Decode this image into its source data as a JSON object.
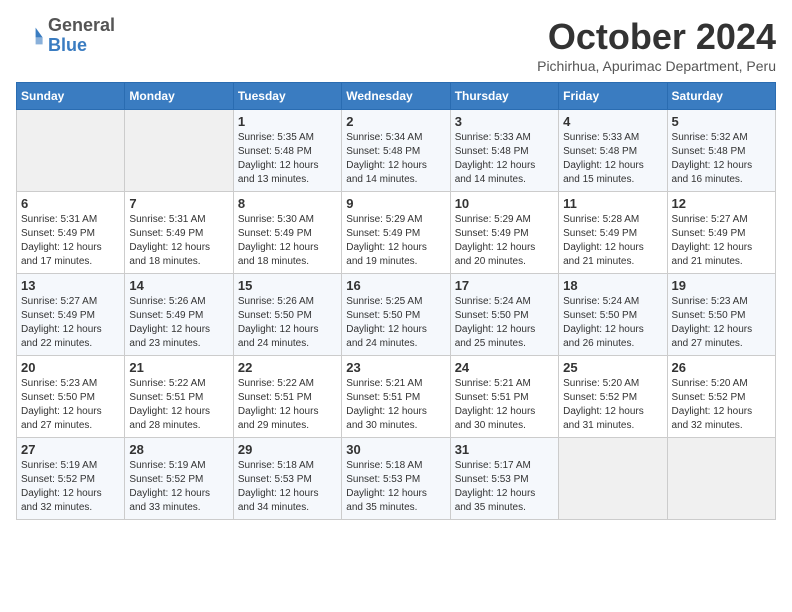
{
  "header": {
    "logo_line1": "General",
    "logo_line2": "Blue",
    "month_title": "October 2024",
    "location": "Pichirhua, Apurimac Department, Peru"
  },
  "weekdays": [
    "Sunday",
    "Monday",
    "Tuesday",
    "Wednesday",
    "Thursday",
    "Friday",
    "Saturday"
  ],
  "weeks": [
    [
      {
        "day": "",
        "empty": true
      },
      {
        "day": "",
        "empty": true
      },
      {
        "day": "1",
        "sunrise": "5:35 AM",
        "sunset": "5:48 PM",
        "daylight": "12 hours and 13 minutes."
      },
      {
        "day": "2",
        "sunrise": "5:34 AM",
        "sunset": "5:48 PM",
        "daylight": "12 hours and 14 minutes."
      },
      {
        "day": "3",
        "sunrise": "5:33 AM",
        "sunset": "5:48 PM",
        "daylight": "12 hours and 14 minutes."
      },
      {
        "day": "4",
        "sunrise": "5:33 AM",
        "sunset": "5:48 PM",
        "daylight": "12 hours and 15 minutes."
      },
      {
        "day": "5",
        "sunrise": "5:32 AM",
        "sunset": "5:48 PM",
        "daylight": "12 hours and 16 minutes."
      }
    ],
    [
      {
        "day": "6",
        "sunrise": "5:31 AM",
        "sunset": "5:49 PM",
        "daylight": "12 hours and 17 minutes."
      },
      {
        "day": "7",
        "sunrise": "5:31 AM",
        "sunset": "5:49 PM",
        "daylight": "12 hours and 18 minutes."
      },
      {
        "day": "8",
        "sunrise": "5:30 AM",
        "sunset": "5:49 PM",
        "daylight": "12 hours and 18 minutes."
      },
      {
        "day": "9",
        "sunrise": "5:29 AM",
        "sunset": "5:49 PM",
        "daylight": "12 hours and 19 minutes."
      },
      {
        "day": "10",
        "sunrise": "5:29 AM",
        "sunset": "5:49 PM",
        "daylight": "12 hours and 20 minutes."
      },
      {
        "day": "11",
        "sunrise": "5:28 AM",
        "sunset": "5:49 PM",
        "daylight": "12 hours and 21 minutes."
      },
      {
        "day": "12",
        "sunrise": "5:27 AM",
        "sunset": "5:49 PM",
        "daylight": "12 hours and 21 minutes."
      }
    ],
    [
      {
        "day": "13",
        "sunrise": "5:27 AM",
        "sunset": "5:49 PM",
        "daylight": "12 hours and 22 minutes."
      },
      {
        "day": "14",
        "sunrise": "5:26 AM",
        "sunset": "5:49 PM",
        "daylight": "12 hours and 23 minutes."
      },
      {
        "day": "15",
        "sunrise": "5:26 AM",
        "sunset": "5:50 PM",
        "daylight": "12 hours and 24 minutes."
      },
      {
        "day": "16",
        "sunrise": "5:25 AM",
        "sunset": "5:50 PM",
        "daylight": "12 hours and 24 minutes."
      },
      {
        "day": "17",
        "sunrise": "5:24 AM",
        "sunset": "5:50 PM",
        "daylight": "12 hours and 25 minutes."
      },
      {
        "day": "18",
        "sunrise": "5:24 AM",
        "sunset": "5:50 PM",
        "daylight": "12 hours and 26 minutes."
      },
      {
        "day": "19",
        "sunrise": "5:23 AM",
        "sunset": "5:50 PM",
        "daylight": "12 hours and 27 minutes."
      }
    ],
    [
      {
        "day": "20",
        "sunrise": "5:23 AM",
        "sunset": "5:50 PM",
        "daylight": "12 hours and 27 minutes."
      },
      {
        "day": "21",
        "sunrise": "5:22 AM",
        "sunset": "5:51 PM",
        "daylight": "12 hours and 28 minutes."
      },
      {
        "day": "22",
        "sunrise": "5:22 AM",
        "sunset": "5:51 PM",
        "daylight": "12 hours and 29 minutes."
      },
      {
        "day": "23",
        "sunrise": "5:21 AM",
        "sunset": "5:51 PM",
        "daylight": "12 hours and 30 minutes."
      },
      {
        "day": "24",
        "sunrise": "5:21 AM",
        "sunset": "5:51 PM",
        "daylight": "12 hours and 30 minutes."
      },
      {
        "day": "25",
        "sunrise": "5:20 AM",
        "sunset": "5:52 PM",
        "daylight": "12 hours and 31 minutes."
      },
      {
        "day": "26",
        "sunrise": "5:20 AM",
        "sunset": "5:52 PM",
        "daylight": "12 hours and 32 minutes."
      }
    ],
    [
      {
        "day": "27",
        "sunrise": "5:19 AM",
        "sunset": "5:52 PM",
        "daylight": "12 hours and 32 minutes."
      },
      {
        "day": "28",
        "sunrise": "5:19 AM",
        "sunset": "5:52 PM",
        "daylight": "12 hours and 33 minutes."
      },
      {
        "day": "29",
        "sunrise": "5:18 AM",
        "sunset": "5:53 PM",
        "daylight": "12 hours and 34 minutes."
      },
      {
        "day": "30",
        "sunrise": "5:18 AM",
        "sunset": "5:53 PM",
        "daylight": "12 hours and 35 minutes."
      },
      {
        "day": "31",
        "sunrise": "5:17 AM",
        "sunset": "5:53 PM",
        "daylight": "12 hours and 35 minutes."
      },
      {
        "day": "",
        "empty": true
      },
      {
        "day": "",
        "empty": true
      }
    ]
  ],
  "labels": {
    "sunrise_prefix": "Sunrise: ",
    "sunset_prefix": "Sunset: ",
    "daylight_prefix": "Daylight: "
  }
}
